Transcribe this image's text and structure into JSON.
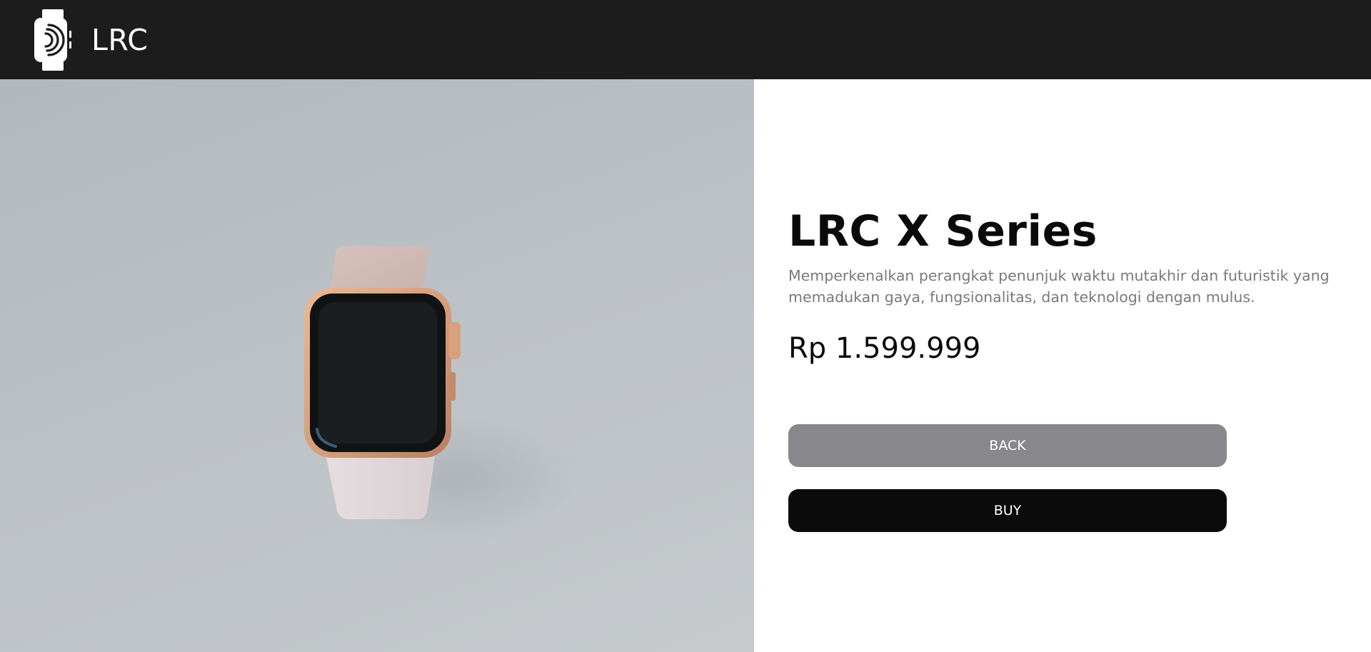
{
  "navbar": {
    "brand": "LRC",
    "logo_icon": "smartwatch-icon"
  },
  "product": {
    "image_icon": "product-photo-watch",
    "title": "LRC X Series",
    "description": "Memperkenalkan perangkat penunjuk waktu mutakhir dan futuristik yang memadukan gaya, fungsionalitas, dan teknologi dengan mulus.",
    "price": "Rp 1.599.999"
  },
  "actions": {
    "back_label": "BACK",
    "buy_label": "BUY"
  },
  "colors": {
    "navbar_bg": "#1c1c1c",
    "back_button": "#88888c",
    "buy_button": "#0b0b0b",
    "description_text": "#7a7a7a"
  }
}
